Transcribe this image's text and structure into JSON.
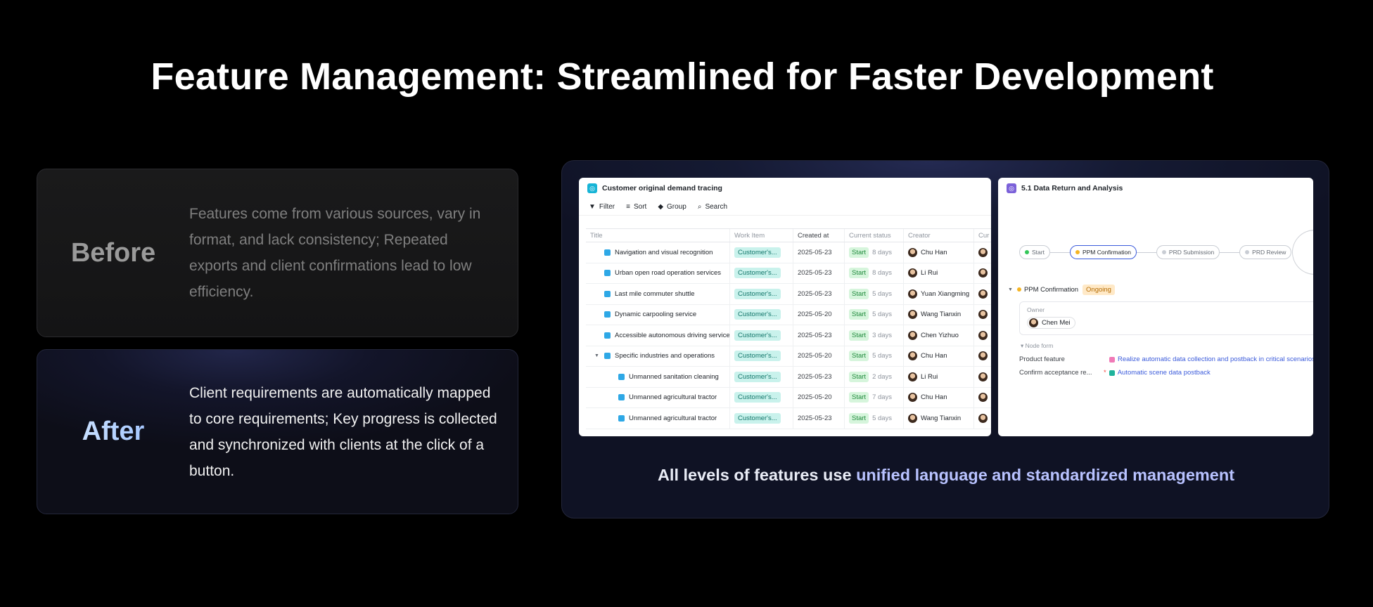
{
  "title": "Feature Management: Streamlined for Faster Development",
  "before": {
    "label": "Before",
    "text": "Features come from various sources, vary in format, and lack consistency; Repeated exports and client confirmations lead to low efficiency."
  },
  "after": {
    "label": "After",
    "text": "Client requirements are automatically mapped to core requirements; Key progress is collected and synchronized with clients at the click of a button."
  },
  "caption": {
    "part1": "All levels of features use ",
    "part2": "unified language and standardized management"
  },
  "left_window": {
    "title": "Customer original demand tracing",
    "toolbar": [
      "Filter",
      "Sort",
      "Group",
      "Search"
    ],
    "columns": [
      "Title",
      "Work Item",
      "Created at",
      "Current status",
      "Creator",
      "Cur"
    ],
    "rows": [
      {
        "title": "Navigation and visual recognition",
        "work": "Customer's...",
        "date": "2025-05-23",
        "status": "Start",
        "days": "8 days",
        "creator": "Chu Han"
      },
      {
        "title": "Urban open road operation services",
        "work": "Customer's...",
        "date": "2025-05-23",
        "status": "Start",
        "days": "8 days",
        "creator": "Li Rui"
      },
      {
        "title": "Last mile commuter shuttle",
        "work": "Customer's...",
        "date": "2025-05-23",
        "status": "Start",
        "days": "5 days",
        "creator": "Yuan Xiangming"
      },
      {
        "title": "Dynamic carpooling service",
        "work": "Customer's...",
        "date": "2025-05-20",
        "status": "Start",
        "days": "5 days",
        "creator": "Wang Tianxin"
      },
      {
        "title": "Accessible autonomous driving service",
        "work": "Customer's...",
        "date": "2025-05-23",
        "status": "Start",
        "days": "3 days",
        "creator": "Chen Yizhuo"
      },
      {
        "title": "Specific industries and operations",
        "work": "Customer's...",
        "date": "2025-05-20",
        "status": "Start",
        "days": "5 days",
        "creator": "Chu Han"
      },
      {
        "title": "Unmanned sanitation cleaning",
        "work": "Customer's...",
        "date": "2025-05-23",
        "status": "Start",
        "days": "2 days",
        "creator": "Li Rui"
      },
      {
        "title": "Unmanned agricultural tractor",
        "work": "Customer's...",
        "date": "2025-05-20",
        "status": "Start",
        "days": "7 days",
        "creator": "Chu Han"
      },
      {
        "title": "Unmanned agricultural tractor",
        "work": "Customer's...",
        "date": "2025-05-23",
        "status": "Start",
        "days": "5 days",
        "creator": "Wang Tianxin"
      }
    ]
  },
  "right_window": {
    "title": "5.1 Data Return and Analysis",
    "flow": [
      "Start",
      "PPM Confirmation",
      "PRD Submission",
      "PRD Review"
    ],
    "node_title": "PPM Confirmation",
    "node_status": "Ongoing",
    "owner_label": "Owner",
    "owner_name": "Chen Mei",
    "form_header": "Node form",
    "form": [
      {
        "key": "Product feature",
        "value": "Realize automatic data collection and postback in critical scenarios"
      },
      {
        "key": "Confirm acceptance re...",
        "value": "Automatic scene data postback"
      }
    ]
  },
  "colors": {
    "accent_blue": "#3b5bdb",
    "tag_teal": "#c9f2ec",
    "status_green": "#d6f5dc",
    "ongoing_orange": "#ffe9c7"
  }
}
